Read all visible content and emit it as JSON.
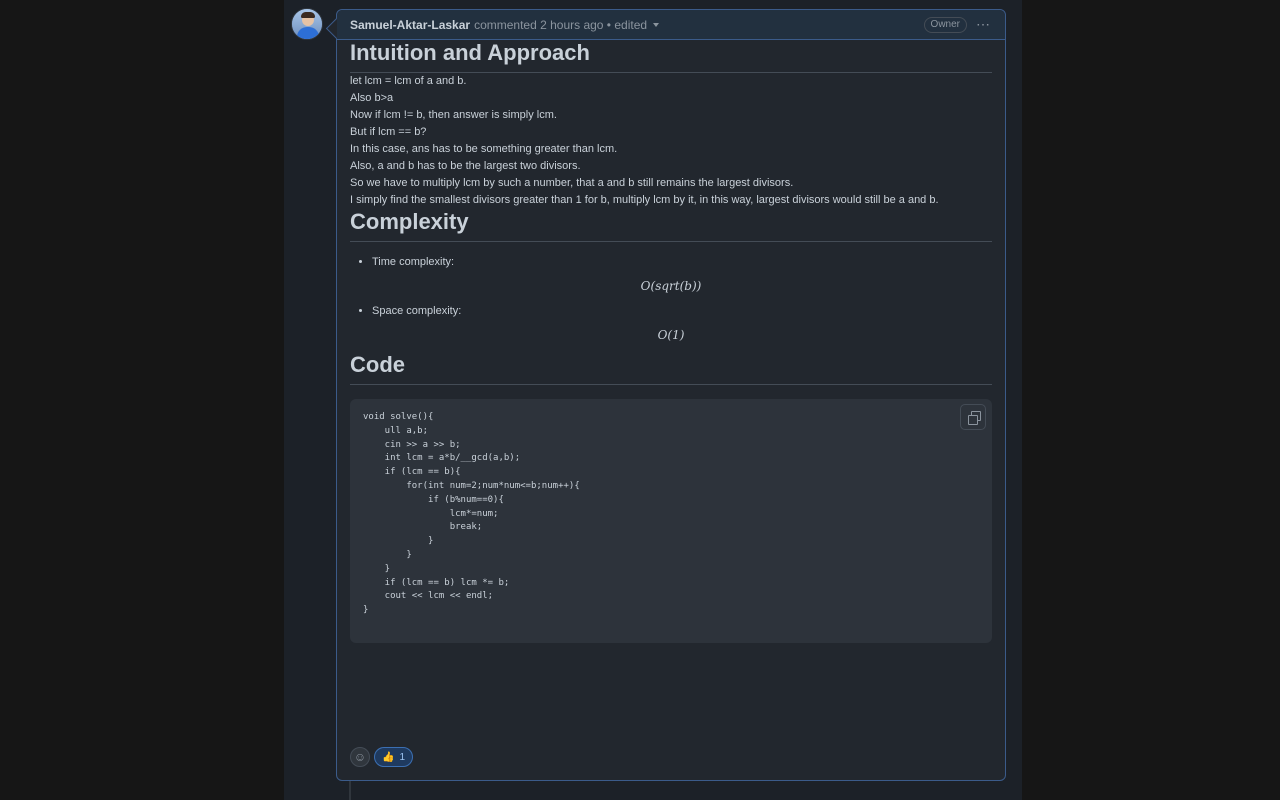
{
  "comment": {
    "author": "Samuel-Aktar-Laskar",
    "meta": "commented 2 hours ago • edited",
    "badge": "Owner"
  },
  "sections": {
    "intuition": {
      "title": "Intuition and Approach",
      "para1": [
        "let lcm = lcm of a and b.",
        "Also b>a",
        "Now if lcm != b, then answer is simply lcm."
      ],
      "para2": [
        "But if lcm == b?",
        "In this case, ans has to be something greater than lcm.",
        "Also, a and b has to be the largest two divisors.",
        "So we have to multiply lcm by such a number, that a and b still remains the largest divisors.",
        "I simply find the smallest divisors greater than 1 for b, multiply lcm by it, in this way, largest divisors would still be a and b."
      ]
    },
    "complexity": {
      "title": "Complexity",
      "time_label": "Time complexity:",
      "time_value": "O(sqrt(b))",
      "space_label": "Space complexity:",
      "space_value": "O(1)"
    },
    "code": {
      "title": "Code",
      "source": "void solve(){\n    ull a,b;\n    cin >> a >> b;\n    int lcm = a*b/__gcd(a,b);\n    if (lcm == b){\n        for(int num=2;num*num<=b;num++){\n            if (b%num==0){\n                lcm*=num;\n                break;\n            }\n        }\n    }\n    if (lcm == b) lcm *= b;\n    cout << lcm << endl;\n}"
    }
  },
  "reactions": {
    "thumbs_count": "1",
    "thumbs_emoji": "👍"
  },
  "icons": [
    "avatar",
    "kebab-icon",
    "copy-icon",
    "smiley-icon",
    "thumbs-up-icon",
    "chevron-down-icon"
  ]
}
